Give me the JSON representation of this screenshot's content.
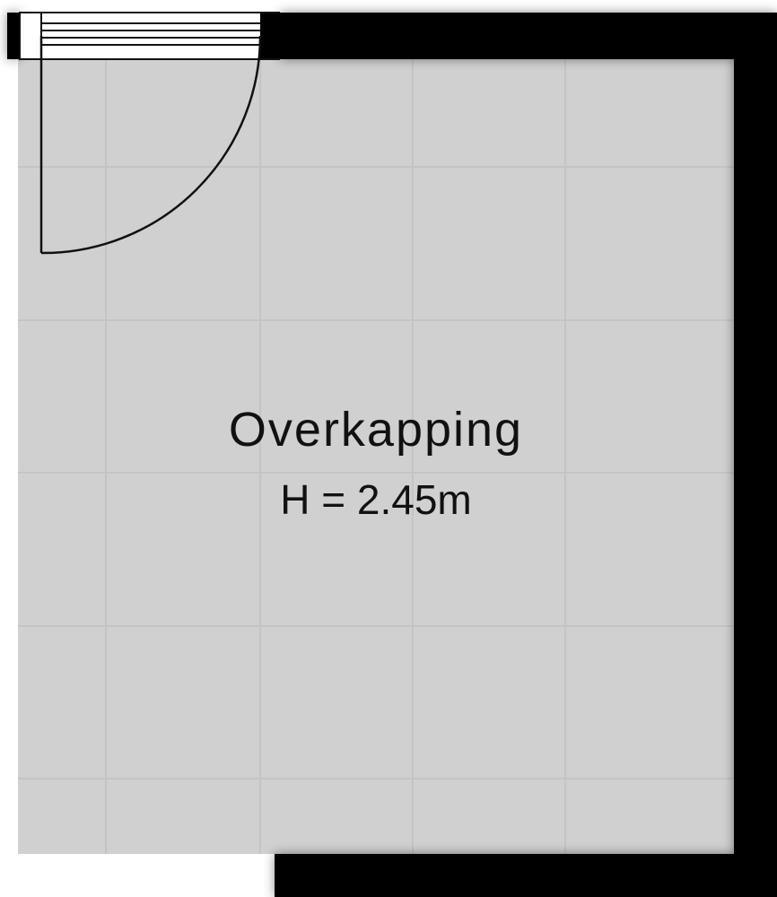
{
  "room": {
    "name": "Overkapping",
    "height_label": "H = 2.45m"
  },
  "colors": {
    "wall": "#000000",
    "floor": "#d0d0d0",
    "tile_line": "#c4c4c4",
    "door_line": "#111111"
  }
}
